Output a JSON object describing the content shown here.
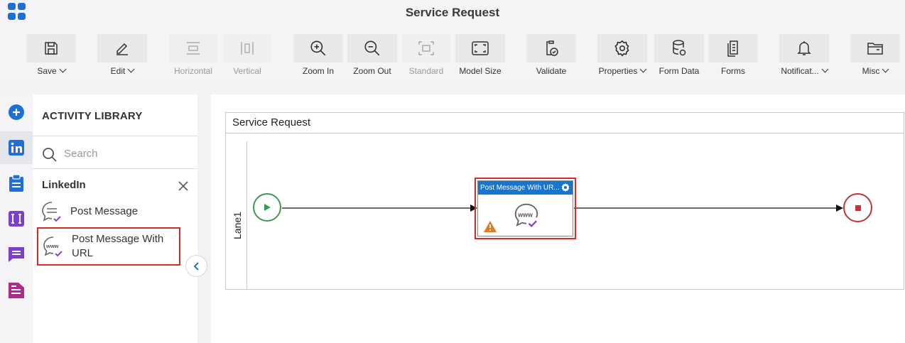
{
  "window": {
    "title": "Service Request"
  },
  "toolbar": {
    "save": "Save",
    "edit": "Edit",
    "horizontal": "Horizontal",
    "vertical": "Vertical",
    "zoom_in": "Zoom In",
    "zoom_out": "Zoom Out",
    "standard": "Standard",
    "model_size": "Model Size",
    "validate": "Validate",
    "properties": "Properties",
    "form_data": "Form Data",
    "forms": "Forms",
    "notifications": "Notificat...",
    "misc": "Misc"
  },
  "rail": {
    "icons": [
      "plus-circle-icon",
      "linkedin-icon",
      "clipboard-icon",
      "text-icon",
      "chat-icon",
      "document-icon"
    ],
    "active": "linkedin-icon"
  },
  "library": {
    "title": "ACTIVITY LIBRARY",
    "search_placeholder": "Search",
    "category": "LinkedIn",
    "items": [
      {
        "label": "Post Message",
        "icon": "chat-message-icon"
      },
      {
        "label": "Post Message With URL",
        "icon": "chat-www-icon"
      }
    ],
    "selected_item": "Post Message With URL"
  },
  "canvas": {
    "pool_title": "Service Request",
    "lane_label": "Lane1",
    "task": {
      "title": "Post Message With UR...",
      "status": "warning"
    }
  },
  "colors": {
    "accent": "#1575d0",
    "highlight": "#d42b2b",
    "start": "#3c9a4f",
    "end": "#c0343a",
    "warning": "#e07b22"
  }
}
